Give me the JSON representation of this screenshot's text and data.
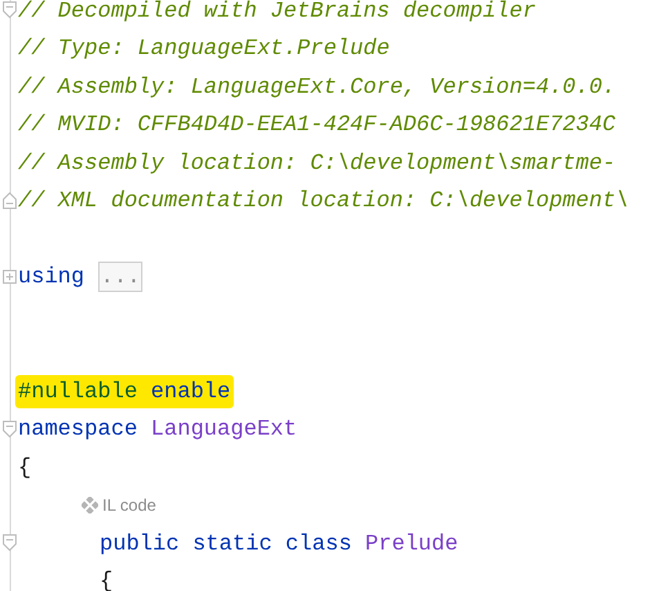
{
  "lines": [
    {
      "kind": "code",
      "fold_start": true,
      "tokens": [
        {
          "kind": "comment",
          "text": "// Decompiled with JetBrains decompiler"
        }
      ]
    },
    {
      "kind": "code",
      "tokens": [
        {
          "kind": "comment",
          "text": "// Type: LanguageExt.Prelude"
        }
      ]
    },
    {
      "kind": "code",
      "tokens": [
        {
          "kind": "comment",
          "text": "// Assembly: LanguageExt.Core, Version=4.0.0."
        }
      ]
    },
    {
      "kind": "code",
      "tokens": [
        {
          "kind": "comment",
          "text": "// MVID: CFFB4D4D-EEA1-424F-AD6C-198621E7234C"
        }
      ]
    },
    {
      "kind": "code",
      "tokens": [
        {
          "kind": "comment",
          "text": "// Assembly location: C:\\development\\smartme-"
        }
      ]
    },
    {
      "kind": "code",
      "fold_end": true,
      "tokens": [
        {
          "kind": "comment",
          "text": "// XML documentation location: C:\\development\\"
        }
      ]
    },
    {
      "kind": "blank"
    },
    {
      "kind": "code",
      "collapsed": true,
      "tokens": [
        {
          "kind": "keyword",
          "text": "using"
        },
        {
          "kind": "placeholder",
          "text": "..."
        }
      ]
    },
    {
      "kind": "blank"
    },
    {
      "kind": "blank"
    },
    {
      "kind": "code",
      "highlighted": true,
      "tokens": [
        {
          "kind": "directive",
          "text": "#nullable"
        },
        {
          "kind": "keyword",
          "text": "enable"
        }
      ]
    },
    {
      "kind": "code",
      "fold_start": true,
      "tokens": [
        {
          "kind": "keyword",
          "text": "namespace"
        },
        {
          "kind": "type",
          "text": "LanguageExt"
        }
      ]
    },
    {
      "kind": "code",
      "tokens": [
        {
          "kind": "plain",
          "text": "{"
        }
      ],
      "children": [
        {
          "kind": "code",
          "tokens": [
            {
              "kind": "inlay",
              "text": "IL code"
            }
          ]
        },
        {
          "kind": "code",
          "fold_start": true,
          "tokens": [
            {
              "kind": "keyword",
              "text": "public"
            },
            {
              "kind": "keyword",
              "text": "static"
            },
            {
              "kind": "keyword",
              "text": "class"
            },
            {
              "kind": "type",
              "text": "Prelude"
            }
          ]
        },
        {
          "kind": "code",
          "tokens": [
            {
              "kind": "plain",
              "text": "{"
            }
          ]
        }
      ]
    }
  ]
}
